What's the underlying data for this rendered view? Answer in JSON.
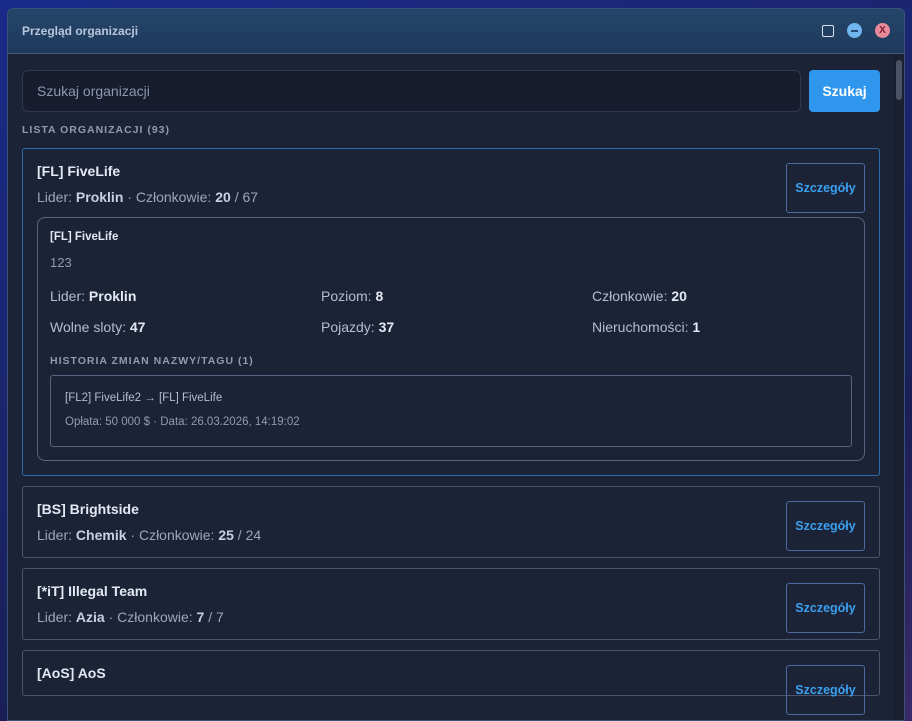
{
  "window": {
    "title": "Przegląd organizacji",
    "close_glyph": "X"
  },
  "search": {
    "placeholder": "Szukaj organizacji",
    "button_label": "Szukaj"
  },
  "list_label": "LISTA ORGANIZACJI (93)",
  "labels": {
    "leader": "Lider:",
    "members": "Członkowie:",
    "details_button": "Szczegóły",
    "level": "Poziom:",
    "free_slots": "Wolne sloty:",
    "vehicles": "Pojazdy:",
    "properties": "Nieruchomości:"
  },
  "orgs": [
    {
      "name": "[FL] FiveLife",
      "leader": "Proklin",
      "members_current": "20",
      "members_max": "67"
    },
    {
      "name": "[BS] Brightside",
      "leader": "Chemik",
      "members_current": "25",
      "members_max": "24"
    },
    {
      "name": "[*iT] Illegal Team",
      "leader": "Azia",
      "members_current": "7",
      "members_max": "7"
    },
    {
      "name": "[AoS] AoS",
      "leader": "",
      "members_current": "",
      "members_max": ""
    }
  ],
  "details": {
    "name": "[FL] FiveLife",
    "description": "123",
    "leader": "Proklin",
    "level": "8",
    "members": "20",
    "free_slots": "47",
    "vehicles": "37",
    "properties": "1",
    "history_label": "HISTORIA ZMIAN NAZWY/TAGU (1)",
    "history": [
      {
        "change": "[FL2] FiveLife2 → [FL] FiveLife",
        "meta": "Opłata: 50 000 $ · Data: 26.03.2026, 14:19:02"
      }
    ]
  },
  "icons": {
    "maximize": "maximize-icon",
    "minimize": "minimize-icon",
    "close": "close-icon"
  },
  "colors": {
    "accent": "#2f96ee",
    "link": "#3aa0f0",
    "window_bg": "#1c2336"
  }
}
